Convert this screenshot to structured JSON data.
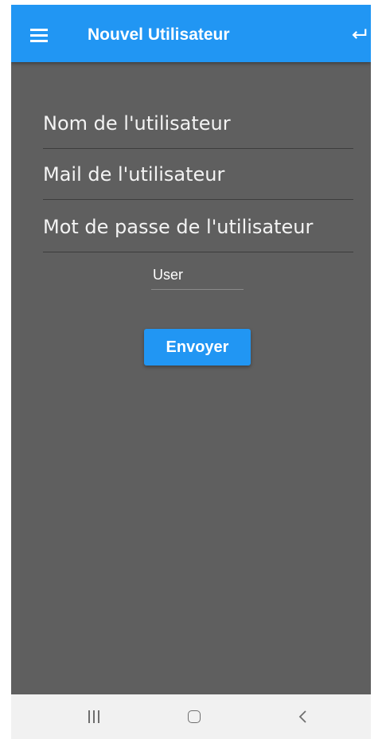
{
  "app_bar": {
    "title": "Nouvel Utilisateur",
    "menu_icon": "hamburger-menu-icon",
    "back_icon": "keyboard-return-icon",
    "color": "#2196f3"
  },
  "form": {
    "name_placeholder": "Nom de l'utilisateur",
    "name_value": "",
    "email_placeholder": "Mail de l'utilisateur",
    "email_value": "",
    "password_placeholder": "Mot de passe de l'utilisateur",
    "password_value": "",
    "role_value": "User",
    "submit_label": "Envoyer"
  },
  "system_nav": {
    "recent_icon": "recent-apps-icon",
    "home_icon": "home-icon",
    "back_icon": "back-chevron-icon"
  },
  "colors": {
    "background": "#5f5f5f",
    "accent": "#2196f3",
    "nav_bar": "#f1f1f1"
  }
}
